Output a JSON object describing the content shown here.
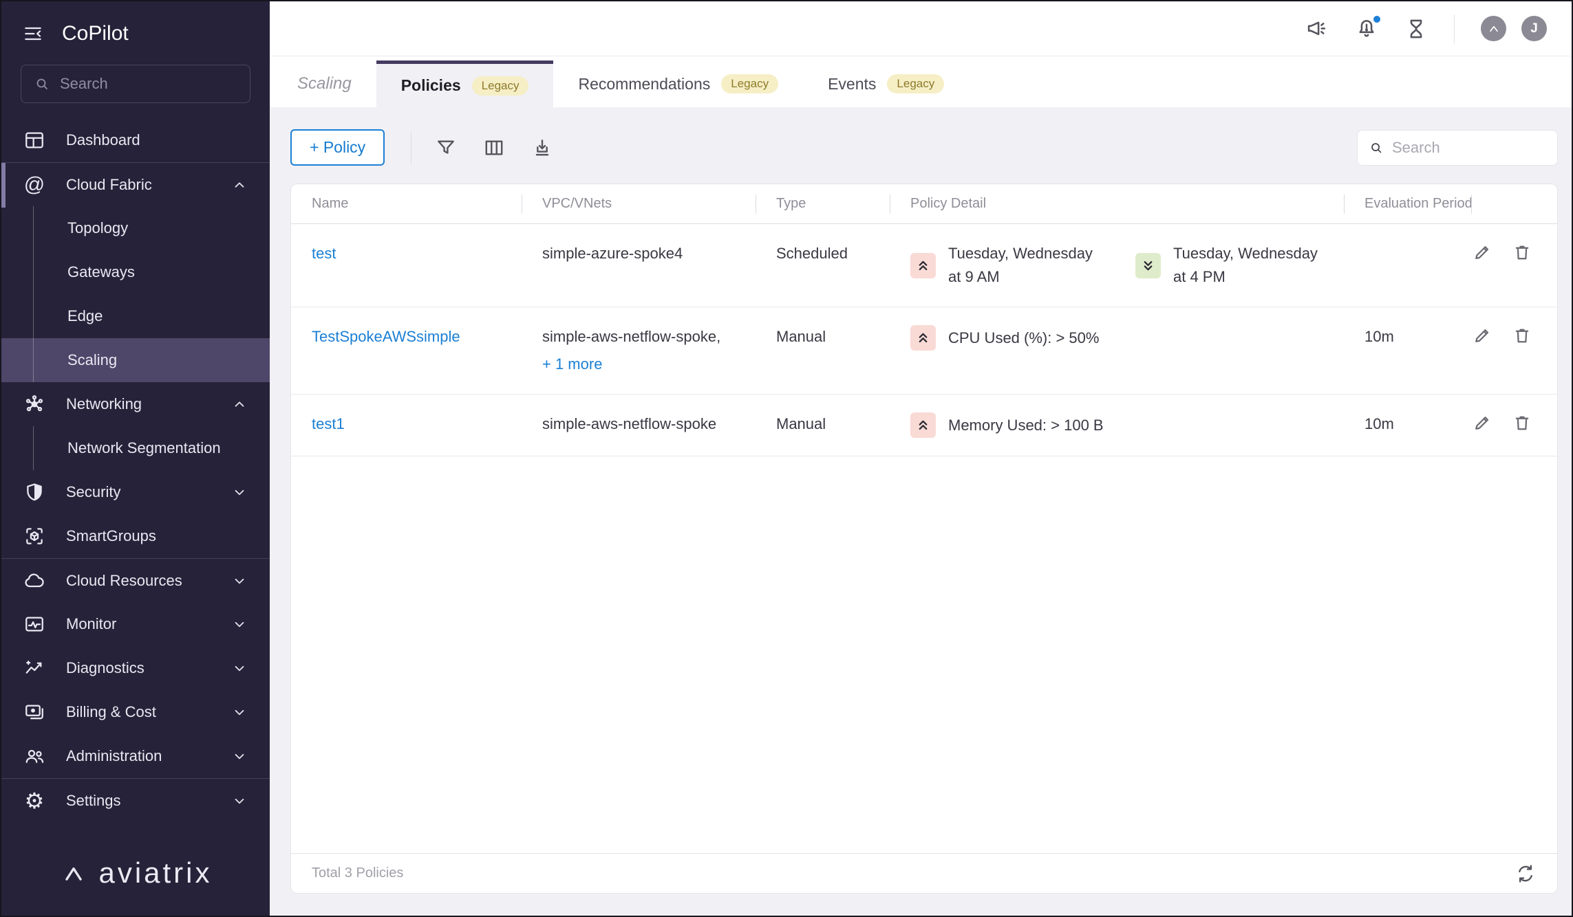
{
  "app": {
    "title": "CoPilot"
  },
  "sidebar": {
    "search_placeholder": "Search",
    "items": {
      "dashboard": "Dashboard",
      "cloud_fabric": "Cloud Fabric",
      "topology": "Topology",
      "gateways": "Gateways",
      "edge": "Edge",
      "scaling": "Scaling",
      "networking": "Networking",
      "network_segmentation": "Network Segmentation",
      "security": "Security",
      "smartgroups": "SmartGroups",
      "cloud_resources": "Cloud Resources",
      "monitor": "Monitor",
      "diagnostics": "Diagnostics",
      "billing_cost": "Billing & Cost",
      "administration": "Administration",
      "settings": "Settings"
    },
    "selected_item": "Scaling",
    "logo_text": "aviatrix"
  },
  "header": {
    "user_initial": "J"
  },
  "tabs": {
    "page_title": "Scaling",
    "items": [
      {
        "label": "Policies",
        "badge": "Legacy",
        "active": true
      },
      {
        "label": "Recommendations",
        "badge": "Legacy",
        "active": false
      },
      {
        "label": "Events",
        "badge": "Legacy",
        "active": false
      }
    ]
  },
  "toolbar": {
    "add_policy_label": "+ Policy",
    "search_placeholder": "Search"
  },
  "table": {
    "columns": [
      "Name",
      "VPC/VNets",
      "Type",
      "Policy Detail",
      "Evaluation Period"
    ],
    "rows": [
      {
        "name": "test",
        "vpc": "simple-azure-spoke4",
        "type": "Scheduled",
        "details": [
          {
            "direction": "scale-up",
            "text": "Tuesday, Wednesday at 9 AM"
          },
          {
            "direction": "scale-down",
            "text": "Tuesday, Wednesday at 4 PM"
          }
        ],
        "evaluation_period": ""
      },
      {
        "name": "TestSpokeAWSsimple",
        "vpc": "simple-aws-netflow-spoke,",
        "vpc_more": "+ 1 more",
        "type": "Manual",
        "details": [
          {
            "direction": "scale-up",
            "text": "CPU Used (%): > 50%"
          }
        ],
        "evaluation_period": "10m"
      },
      {
        "name": "test1",
        "vpc": "simple-aws-netflow-spoke",
        "type": "Manual",
        "details": [
          {
            "direction": "scale-up",
            "text": "Memory Used: > 100 B"
          }
        ],
        "evaluation_period": "10m"
      }
    ],
    "footer_total": "Total 3 Policies"
  },
  "colors": {
    "sidebar_bg": "#262239",
    "sidebar_selected": "#4e4769",
    "sidebar_accent_bar": "#837ca6",
    "accent_blue": "#1b7fd4",
    "content_bg": "#f1f0f5",
    "tab_active_border": "#443b61",
    "legacy_badge_bg": "#f6eec5",
    "legacy_badge_text": "#8d7b2a",
    "scale_up_badge_bg": "#f9dad5",
    "scale_down_badge_bg": "#dfeccb",
    "notification_dot": "#1d7fd8"
  }
}
